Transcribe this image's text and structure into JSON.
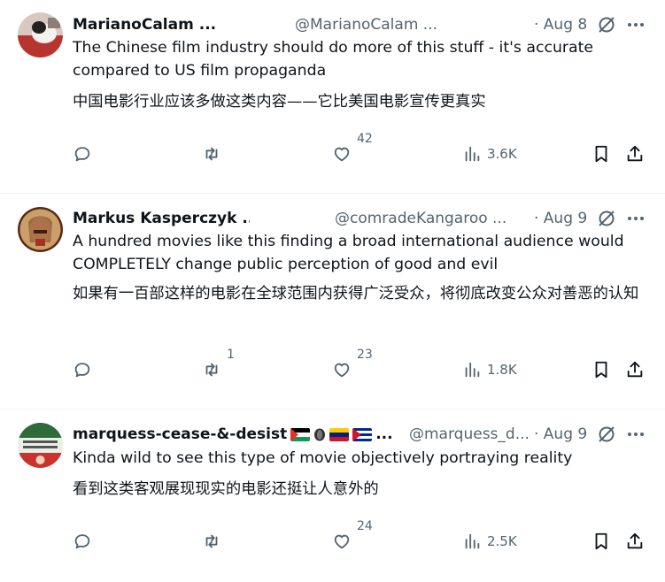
{
  "tweets": [
    {
      "name": "MarianoCalam ...",
      "handle": "@MarianoCalam ...",
      "date": "· Aug 8",
      "text_en": "The Chinese film industry should do more of this stuff - it's accurate compared to US film propaganda",
      "text_zh": "中国电影行业应该多做这类内容——它比美国电影宣传更真实",
      "reply_count": "",
      "retweet_count": "",
      "like_count": "42",
      "views": "3.6K"
    },
    {
      "name": "Markus Kasperczyk ...",
      "handle": "@comradeKangaroo ...",
      "date": "· Aug 9",
      "text_en": "A hundred movies like this finding a broad international audience would COMPLETELY change public perception of good and evil",
      "text_zh": "如果有一百部这样的电影在全球范围内获得广泛受众，将彻底改变公众对善恶的认知",
      "reply_count": "",
      "retweet_count": "1",
      "like_count": "23",
      "views": "1.8K"
    },
    {
      "name": "marquess-cease-&-desist",
      "name_suffix": "...",
      "handle": "@marquess_d...",
      "date": "· Aug 9",
      "text_en": "Kinda wild to see this type of movie objectively portraying reality",
      "text_zh": "看到这类客观展现现实的电影还挺让人意外的",
      "reply_count": "",
      "retweet_count": "",
      "like_count": "24",
      "views": "2.5K"
    }
  ],
  "icons": [
    "reply-icon",
    "retweet-icon",
    "like-icon",
    "views-icon",
    "bookmark-icon",
    "share-icon",
    "grok-icon",
    "more-icon"
  ],
  "colors": {
    "text": "#0f1419",
    "secondary": "#536471",
    "divider": "#eff3f4"
  }
}
